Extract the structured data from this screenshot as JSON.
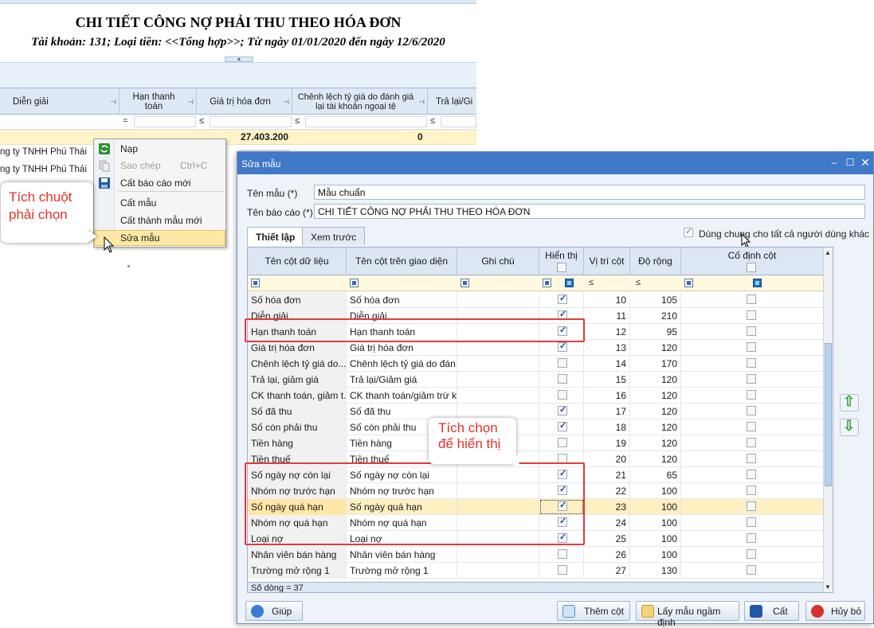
{
  "report": {
    "title": "CHI TIẾT CÔNG NỢ PHẢI THU THEO HÓA ĐƠN",
    "subtitle": "Tài khoản: 131; Loại tiền: <<Tổng hợp>>; Từ ngày 01/01/2020 đến ngày 12/6/2020",
    "columns": [
      "Diễn giải",
      "Hạn thanh toán",
      "Giá trị hóa đơn",
      "Chênh lệch tỷ giá do đánh giá lại tài khoản ngoại tệ",
      "Trả lại/Gi"
    ],
    "filters": [
      "=",
      "≤",
      "≤",
      "≤"
    ],
    "total_invoice": "27.403.200",
    "total_diff": "0",
    "rows": [
      "ng ty TNHH Phú Thái",
      "ng ty TNHH Phú Thái"
    ]
  },
  "context_menu": {
    "items": [
      {
        "label": "Nạp",
        "shortcut": "",
        "icon": "refresh-icon"
      },
      {
        "label": "Sao chép",
        "shortcut": "Ctrl+C",
        "icon": "copy-icon"
      },
      {
        "label": "Cất báo cáo mới",
        "shortcut": "",
        "icon": "save-icon"
      },
      {
        "label": "Cất mẫu",
        "shortcut": "",
        "icon": ""
      },
      {
        "label": "Cất thành mẫu mới",
        "shortcut": "",
        "icon": ""
      },
      {
        "label": "Sửa mẫu",
        "shortcut": "",
        "icon": ""
      }
    ]
  },
  "callout_right_click": "Tích chuột phải chọn",
  "callout_check": "Tích chọn để hiển thị",
  "dialog": {
    "title": "Sửa mẫu",
    "template_name_label": "Tên mẫu (*)",
    "template_name_value": "Mẫu chuẩn",
    "report_name_label": "Tên báo cáo (*)",
    "report_name_value": "CHI TIẾT CÔNG NỢ PHẢI THU THEO HÓA ĐƠN",
    "tabs": [
      "Thiết lập",
      "Xem trước"
    ],
    "share_label": "Dùng chung cho tất cả người dùng khác",
    "share_checked": true,
    "columns": [
      "Tên cột dữ liệu",
      "Tên cột trên giao diện",
      "Ghi chú",
      "Hiển thị",
      "Vị trí cột",
      "Độ rộng",
      "Cố định cột"
    ],
    "filter_le": "≤",
    "rows": [
      {
        "data_col": "Số hóa đơn",
        "ui_col": "Số hóa đơn",
        "visible": true,
        "pos": "10",
        "width": "105"
      },
      {
        "data_col": "Diễn giải",
        "ui_col": "Diễn giải",
        "visible": true,
        "pos": "11",
        "width": "210"
      },
      {
        "data_col": "Hạn thanh toán",
        "ui_col": "Hạn thanh toán",
        "visible": true,
        "pos": "12",
        "width": "95"
      },
      {
        "data_col": "Giá trị hóa đơn",
        "ui_col": "Giá trị hóa đơn",
        "visible": true,
        "pos": "13",
        "width": "120"
      },
      {
        "data_col": "Chênh lệch tỷ giá do...",
        "ui_col": "Chênh lệch tỷ giá do đán...",
        "visible": false,
        "pos": "14",
        "width": "170"
      },
      {
        "data_col": "Trả lại, giảm giá",
        "ui_col": "Trả lại/Giảm giá",
        "visible": false,
        "pos": "15",
        "width": "120"
      },
      {
        "data_col": "CK thanh toán, giảm t...",
        "ui_col": "CK thanh toán/giảm trừ k...",
        "visible": false,
        "pos": "16",
        "width": "120"
      },
      {
        "data_col": "Số đã thu",
        "ui_col": "Số đã thu",
        "visible": true,
        "pos": "17",
        "width": "120"
      },
      {
        "data_col": "Số còn phải thu",
        "ui_col": "Số còn phải thu",
        "visible": true,
        "pos": "18",
        "width": "120"
      },
      {
        "data_col": "Tiền hàng",
        "ui_col": "Tiền hàng",
        "visible": false,
        "pos": "19",
        "width": "120"
      },
      {
        "data_col": "Tiền thuế",
        "ui_col": "Tiền thuế",
        "visible": false,
        "pos": "20",
        "width": "120"
      },
      {
        "data_col": "Số ngày nợ còn lại",
        "ui_col": "Số ngày nợ còn lại",
        "visible": true,
        "pos": "21",
        "width": "65"
      },
      {
        "data_col": "Nhóm nợ trước hạn",
        "ui_col": "Nhóm nợ trước hạn",
        "visible": true,
        "pos": "22",
        "width": "100"
      },
      {
        "data_col": "Số ngày quá hạn",
        "ui_col": "Số ngày quá hạn",
        "visible": true,
        "pos": "23",
        "width": "100"
      },
      {
        "data_col": "Nhóm nợ quá hạn",
        "ui_col": "Nhóm nợ quá hạn",
        "visible": true,
        "pos": "24",
        "width": "100"
      },
      {
        "data_col": "Loại nợ",
        "ui_col": "Loại nợ",
        "visible": true,
        "pos": "25",
        "width": "100"
      },
      {
        "data_col": "Nhân viên bán hàng",
        "ui_col": "Nhân viên bán hàng",
        "visible": false,
        "pos": "26",
        "width": "100"
      },
      {
        "data_col": "Trường mở rộng 1",
        "ui_col": "Trường mở rộng 1",
        "visible": false,
        "pos": "27",
        "width": "130"
      }
    ],
    "row_count": "Số dòng = 37",
    "buttons": {
      "help": "Giúp",
      "add_col": "Thêm cột",
      "default": "Lấy mẫu ngầm định",
      "save": "Cất",
      "cancel": "Hủy bỏ"
    }
  }
}
